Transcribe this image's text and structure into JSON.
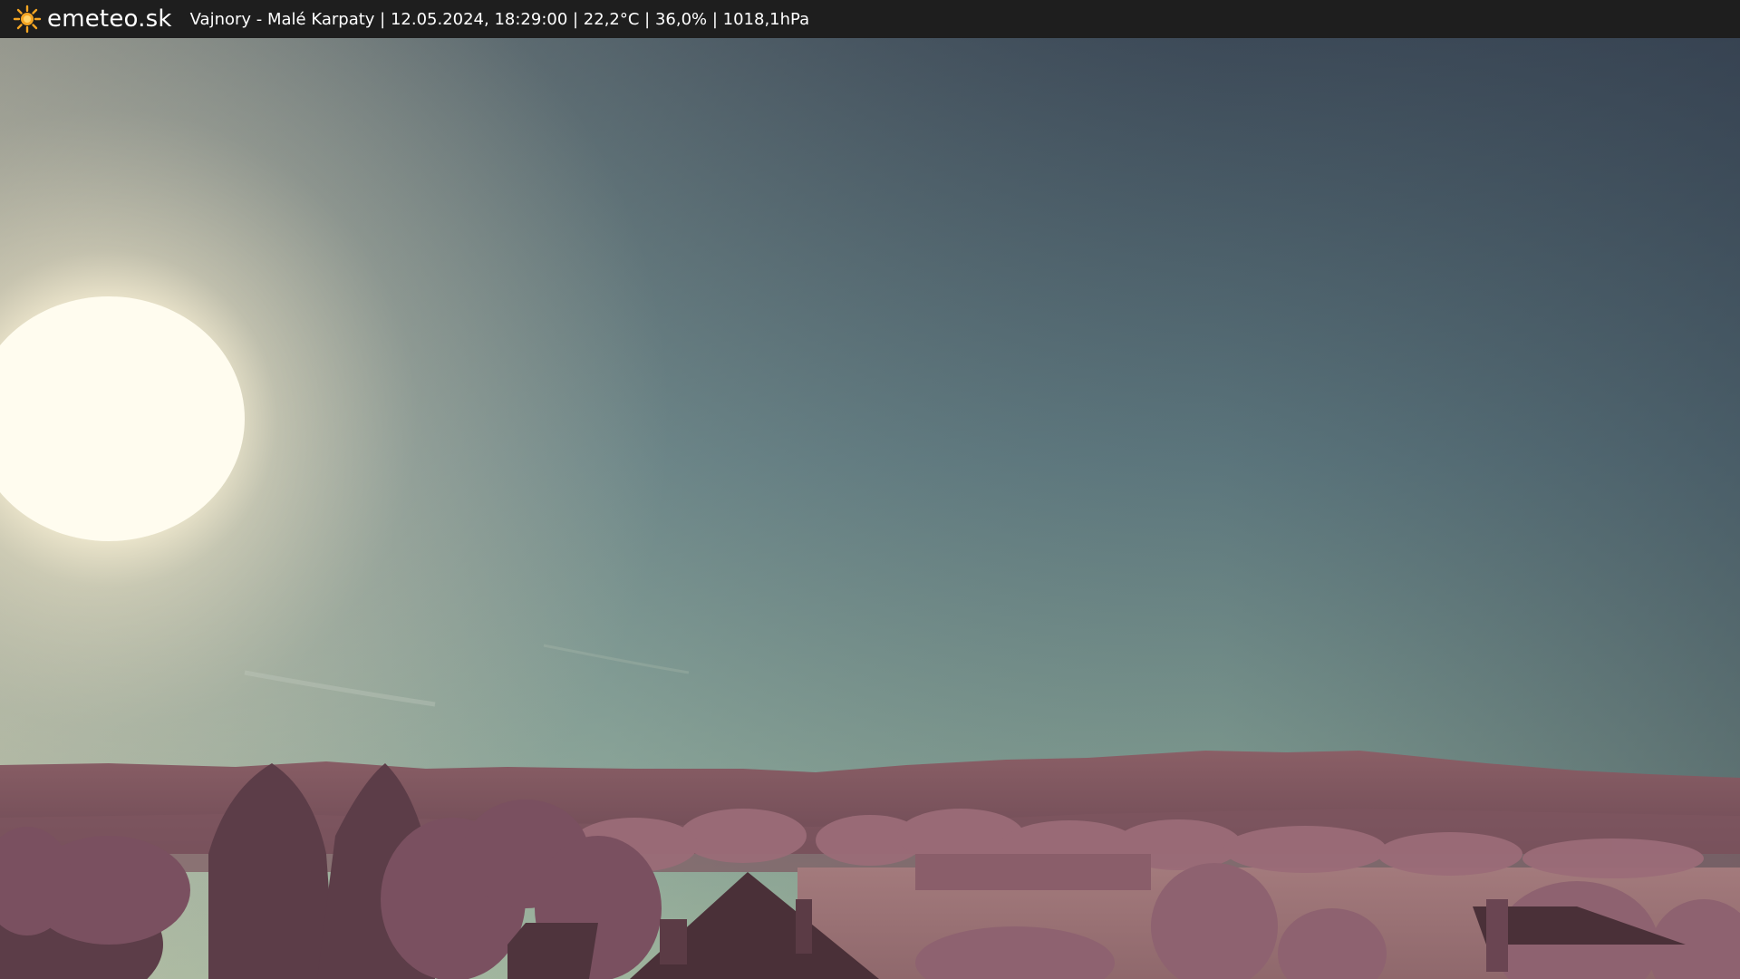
{
  "header": {
    "logo_icon": "sun-icon",
    "site_name": "emeteo.sk",
    "caption": "Vajnory - Malé Karpaty | 12.05.2024, 18:29:00 | 22,2°C | 36,0% | 1018,1hPa"
  },
  "colors": {
    "bar_background": "#1e1e1e",
    "logo_sun": "#f5a623",
    "sky_top_right": "#3a4552",
    "sky_horizon": "#8fa79a",
    "vegetation": "#8a5a6a"
  }
}
